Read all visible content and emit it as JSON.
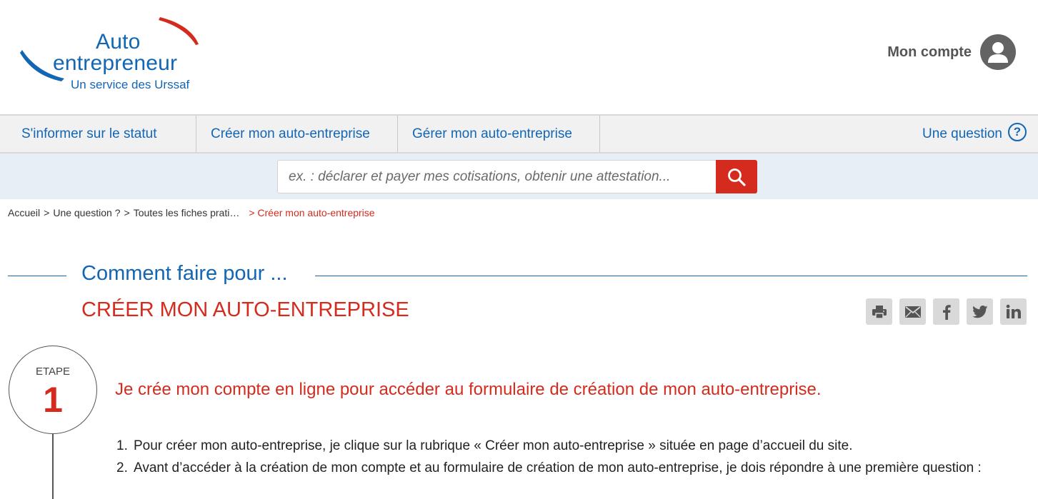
{
  "header": {
    "logo": {
      "line1": "Auto",
      "line2": "entrepreneur",
      "tagline": "Un service des Urssaf"
    },
    "account_label": "Mon compte"
  },
  "nav": {
    "items": [
      {
        "label": "S'informer sur le statut"
      },
      {
        "label": "Créer mon auto-entreprise"
      },
      {
        "label": "Gérer mon auto-entreprise"
      }
    ],
    "question_label": "Une question",
    "question_icon": "?"
  },
  "search": {
    "placeholder": "ex. : déclarer et payer mes cotisations, obtenir une attestation..."
  },
  "breadcrumb": {
    "items": [
      "Accueil",
      "Une question ?",
      "Toutes les fiches prati…"
    ],
    "separator": ">",
    "current": "> Créer mon auto-entreprise"
  },
  "page": {
    "how_title": "Comment faire pour ...",
    "main_title": "CRÉER MON AUTO-ENTREPRISE"
  },
  "share": {
    "icons": [
      "print-icon",
      "mail-icon",
      "facebook-icon",
      "twitter-icon",
      "linkedin-icon"
    ]
  },
  "step": {
    "label": "ETAPE",
    "number": "1",
    "heading": "Je crée mon compte en ligne pour accéder au formulaire de création de mon auto-entreprise.",
    "items": [
      {
        "num": "1.",
        "text": "Pour créer mon auto-entreprise, je clique sur la rubrique « Créer mon auto-entreprise » située en page d’accueil du site."
      },
      {
        "num": "2.",
        "text": "Avant d’accéder à la création de mon compte et au formulaire de création de mon auto-entreprise, je dois répondre à une première question :"
      }
    ]
  },
  "colors": {
    "brand_blue": "#1366b3",
    "accent_red": "#d52b1e",
    "nav_bg": "#f1f1f1",
    "search_band_bg": "#e8eef6"
  }
}
